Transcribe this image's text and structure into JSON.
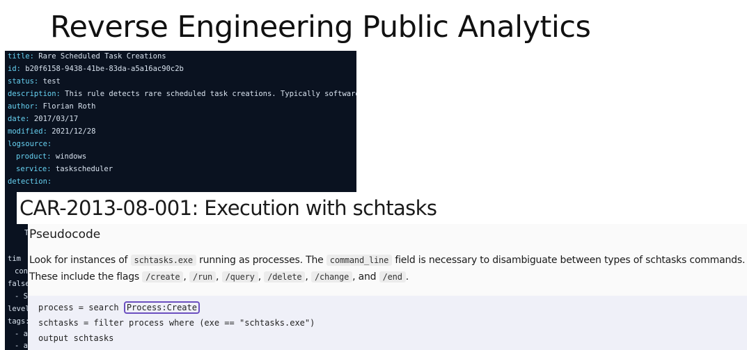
{
  "slide": {
    "title": "Reverse Engineering Public Analytics"
  },
  "yaml": {
    "title_key": "title:",
    "title_val": " Rare Scheduled Task Creations",
    "id_key": "id:",
    "id_val": " b20f6158-9438-41be-83da-a5a16ac90c2b",
    "status_key": "status:",
    "status_val": " test",
    "description_key": "description:",
    "description_val": " This rule detects rare scheduled task creations. Typically software",
    "author_key": "author:",
    "author_val": " Florian Roth",
    "date_key": "date:",
    "date_val": " 2017/03/17",
    "modified_key": "modified:",
    "modified_val": " 2021/12/28",
    "logsource_key": "logsource:",
    "product_key": "product:",
    "product_val": " windows",
    "service_key": "service:",
    "service_val": " taskscheduler",
    "detection_key": "detection:",
    "frag_T": "T",
    "frag_tim": "tim",
    "frag_con": "con",
    "frag_false": "false",
    "frag_dash_S": "- S",
    "frag_level": "level",
    "frag_tags": "tags:",
    "frag_dash_a1": "- a",
    "frag_dash_a2": "- a"
  },
  "car": {
    "title": "CAR-2013-08-001: Execution with schtasks",
    "section_heading": "Pseudocode",
    "p1_a": "Look for instances of ",
    "p1_code1": "schtasks.exe",
    "p1_b": " running as processes. The ",
    "p1_code2": "command_line",
    "p1_c": " field is necessary to disambiguate between types of schtasks commands.",
    "p2_a": "These include the flags ",
    "flag_create": "/create",
    "flag_run": "/run",
    "flag_query": "/query",
    "flag_delete": "/delete",
    "flag_change": "/change",
    "flag_end": "/end",
    "sep": ", ",
    "and": ", and ",
    "period": ".",
    "code_line1_prefix": "process = search ",
    "code_line1_highlight": "Process:Create",
    "code_line2": "schtasks = filter process where (exe == \"schtasks.exe\")",
    "code_line3": "output schtasks"
  },
  "colors": {
    "yaml_bg": "#0a1220",
    "yaml_key": "#67d2f2",
    "highlight_border": "#6b4fbf",
    "code_block_bg": "#eff0f8"
  }
}
